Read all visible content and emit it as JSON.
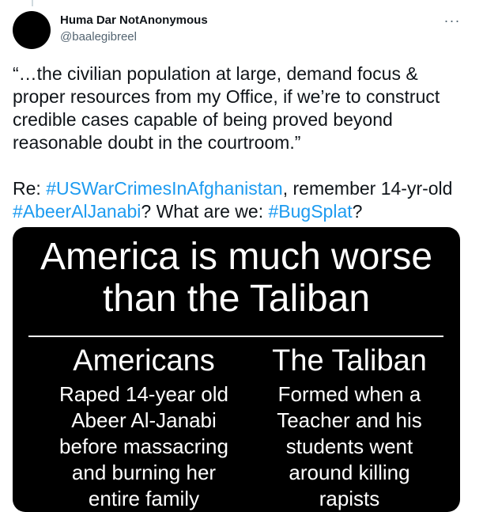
{
  "tweet": {
    "author": {
      "name": "Huma Dar NotAnonymous",
      "handle": "@baalegibreel"
    },
    "more_glyph": "···",
    "text_para1": "“…the civilian population at large, demand focus & proper resources from my Office, if we’re to construct credible cases capable of being proved beyond reasonable doubt in the courtroom.”",
    "text_para2": {
      "prefix": "Re: ",
      "hashtag1": "#USWarCrimesInAfghanistan",
      "mid1": ", remember 14-yr-old ",
      "hashtag2": "#AbeerAlJanabi",
      "mid2": "? What are we: ",
      "hashtag3": "#BugSplat",
      "suffix": "?"
    },
    "colors": {
      "link": "#1d9bf0",
      "text": "#0f1419",
      "secondary": "#536471"
    }
  },
  "media": {
    "title_line1": "America is much worse",
    "title_line2": "than the Taliban",
    "left_heading": "Americans",
    "left_lines": [
      "Raped 14-year old",
      "Abeer Al-Janabi",
      "before massacring",
      "and burning her",
      "entire family"
    ],
    "right_heading": "The Taliban",
    "right_lines": [
      "Formed when a",
      "Teacher and his",
      "students went",
      "around killing",
      "rapists"
    ]
  }
}
